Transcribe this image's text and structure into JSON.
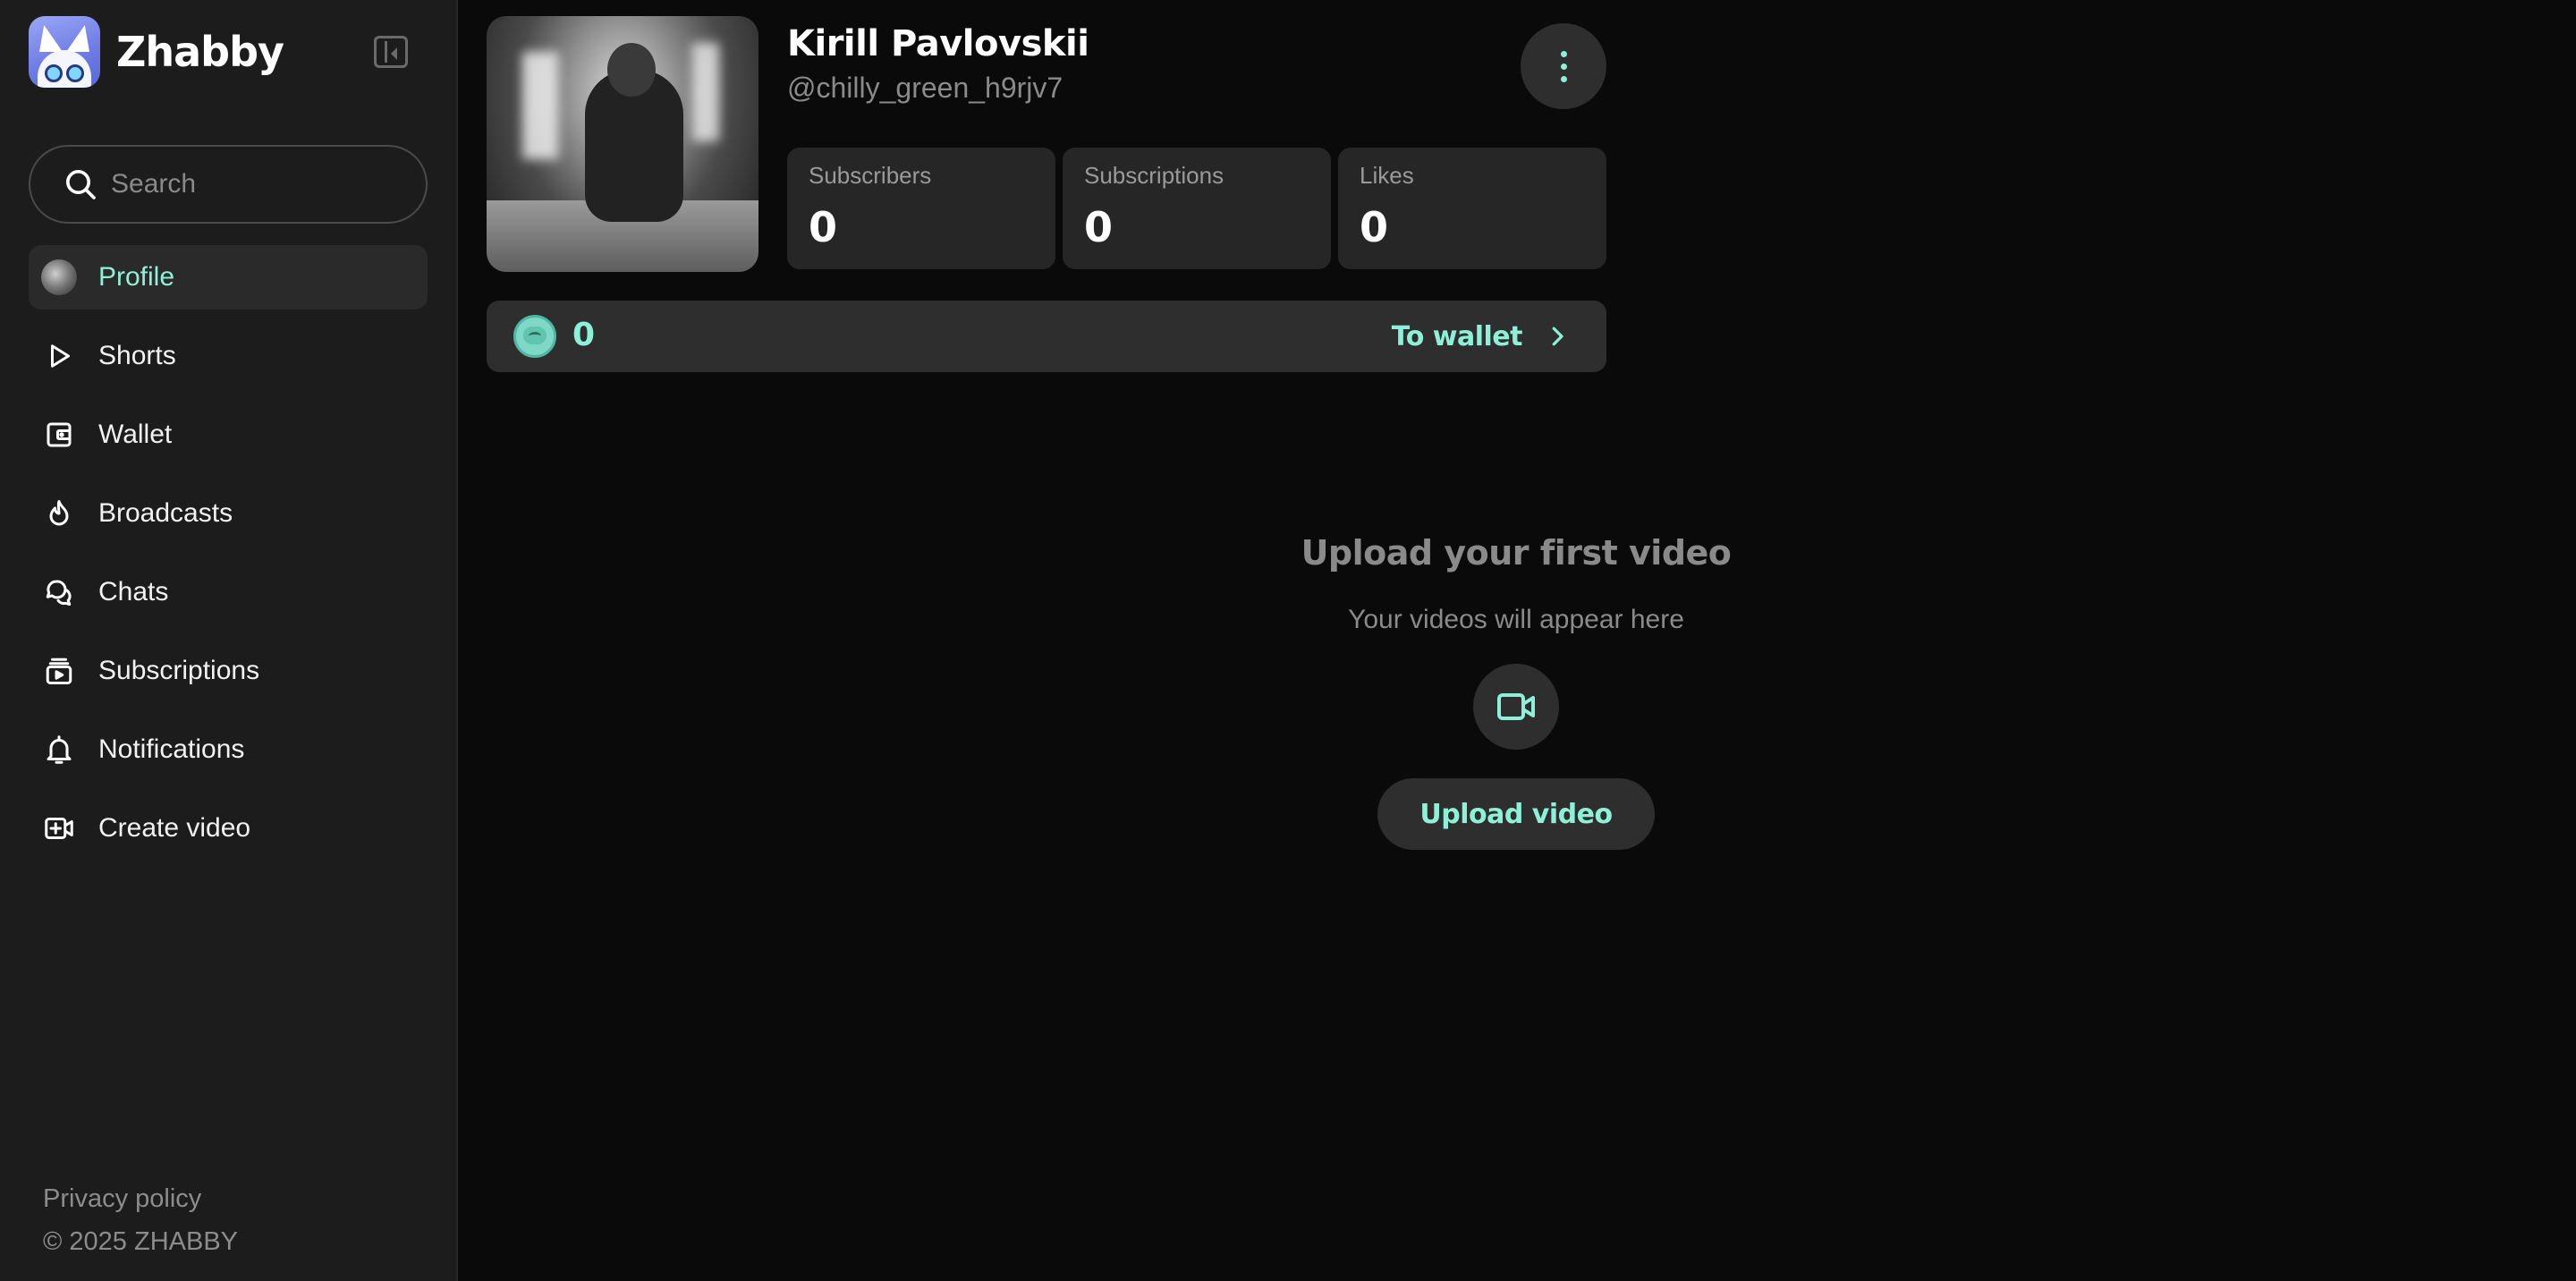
{
  "app": {
    "name": "Zhabby",
    "accent_color": "#8ff0d8"
  },
  "search": {
    "placeholder": "Search"
  },
  "sidebar": {
    "items": [
      {
        "label": "Profile",
        "icon": "avatar",
        "active": true
      },
      {
        "label": "Shorts",
        "icon": "play-icon"
      },
      {
        "label": "Wallet",
        "icon": "wallet-icon"
      },
      {
        "label": "Broadcasts",
        "icon": "flame-icon"
      },
      {
        "label": "Chats",
        "icon": "chat-bubbles-icon"
      },
      {
        "label": "Subscriptions",
        "icon": "subscriptions-icon"
      },
      {
        "label": "Notifications",
        "icon": "bell-icon"
      },
      {
        "label": "Create video",
        "icon": "add-video-icon"
      }
    ],
    "footer": {
      "privacy": "Privacy policy",
      "copyright": "© 2025 ZHABBY"
    }
  },
  "profile": {
    "name": "Kirill Pavlovskii",
    "handle": "@chilly_green_h9rjv7",
    "stats": [
      {
        "label": "Subscribers",
        "value": "0"
      },
      {
        "label": "Subscriptions",
        "value": "0"
      },
      {
        "label": "Likes",
        "value": "0"
      }
    ]
  },
  "wallet": {
    "balance": "0",
    "link_label": "To wallet"
  },
  "empty_state": {
    "title": "Upload your first video",
    "subtitle": "Your videos will appear here",
    "button_label": "Upload video"
  }
}
